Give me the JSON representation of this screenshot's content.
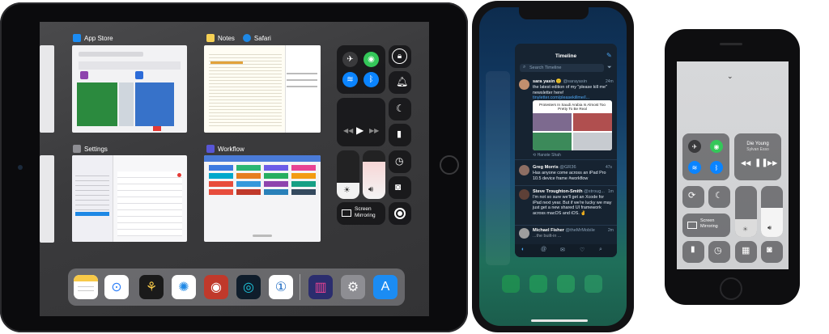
{
  "ipad": {
    "cards": {
      "app_store": {
        "title": "App Store"
      },
      "notes": {
        "title": "Notes"
      },
      "safari": {
        "title": "Safari"
      },
      "settings": {
        "title": "Settings"
      },
      "workflow": {
        "title": "Workflow"
      }
    },
    "control_center": {
      "screen_mirroring": "Screen\nMirroring"
    },
    "dock_apps": [
      "Notes",
      "Airmail",
      "Tes",
      "Safari",
      "Tweetbot",
      "1Blocker",
      "1Password",
      "Overcast",
      "Settings",
      "App Store"
    ]
  },
  "iphone_x": {
    "timeline": {
      "title": "Timeline",
      "search_placeholder": "Search Timeline",
      "tweets": [
        {
          "name": "sara yasin 😑",
          "handle": "@sarayasin",
          "time": "24m",
          "text": "the latest edition of my \"please kill me\" newsletter here! ",
          "link": "tinyletter.com/pleasekillme/l...",
          "retweet": "Hanote Shah"
        },
        {
          "name": "Greg Morris",
          "handle": "@GR36",
          "time": "47s",
          "text": "Has anyone come across an iPad Pro 10.5 device frame #workflow"
        },
        {
          "name": "Steve Troughton-Smith",
          "handle": "@stroug...",
          "time": "1m",
          "text": "I'm not so sure we'll get an Xcode for iPad next year. But if we're lucky we may just get a new shared UI framework across macOS and iOS. ✌"
        },
        {
          "name": "Michael Fisher",
          "handle": "@theMrMobile",
          "time": "2m",
          "text": "...the built-in ..."
        }
      ],
      "preview_headline": "Protesters In Saudi Arabia Is Almost Too Pretty To Be Real"
    }
  },
  "iphone_7": {
    "now_playing": {
      "title": "Die Young",
      "artist": "Sylvan Esso"
    },
    "screen_mirroring": "Screen\nMirroring"
  },
  "colors": {
    "ios_green": "#34c759",
    "ios_blue": "#0a84ff",
    "ios_orange": "#f5a623",
    "tweetbot_dark": "#162331"
  }
}
